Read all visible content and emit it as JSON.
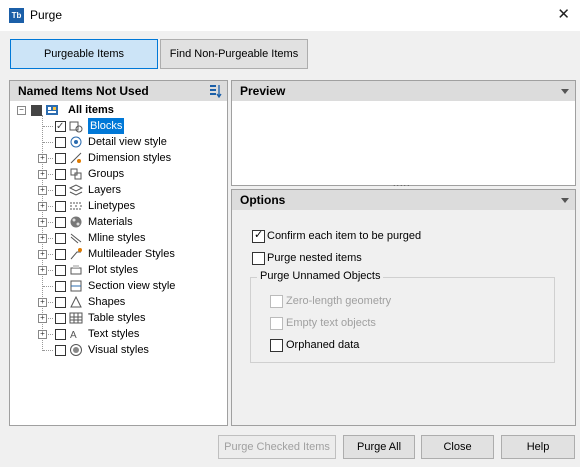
{
  "window": {
    "app_icon": "Tb",
    "title": "Purge",
    "close": "✕"
  },
  "top_buttons": {
    "purgeable": "Purgeable Items",
    "non_purgeable": "Find Non-Purgeable Items"
  },
  "left_panel": {
    "header": "Named Items Not Used",
    "root": "All items",
    "items": [
      {
        "label": "Blocks",
        "icon": "blocks-icon",
        "expandable": false,
        "checked": true,
        "selected": true
      },
      {
        "label": "Detail view style",
        "icon": "detail-view-icon",
        "expandable": false,
        "checked": false
      },
      {
        "label": "Dimension styles",
        "icon": "dimension-icon",
        "expandable": true,
        "checked": false
      },
      {
        "label": "Groups",
        "icon": "groups-icon",
        "expandable": true,
        "checked": false
      },
      {
        "label": "Layers",
        "icon": "layers-icon",
        "expandable": true,
        "checked": false
      },
      {
        "label": "Linetypes",
        "icon": "linetypes-icon",
        "expandable": true,
        "checked": false
      },
      {
        "label": "Materials",
        "icon": "materials-icon",
        "expandable": true,
        "checked": false
      },
      {
        "label": "Mline styles",
        "icon": "mline-icon",
        "expandable": true,
        "checked": false
      },
      {
        "label": "Multileader Styles",
        "icon": "multileader-icon",
        "expandable": true,
        "checked": false
      },
      {
        "label": "Plot styles",
        "icon": "plot-icon",
        "expandable": true,
        "checked": false
      },
      {
        "label": "Section view style",
        "icon": "section-view-icon",
        "expandable": false,
        "checked": false
      },
      {
        "label": "Shapes",
        "icon": "shapes-icon",
        "expandable": true,
        "checked": false
      },
      {
        "label": "Table styles",
        "icon": "table-icon",
        "expandable": true,
        "checked": false
      },
      {
        "label": "Text styles",
        "icon": "text-icon",
        "expandable": true,
        "checked": false
      },
      {
        "label": "Visual styles",
        "icon": "visual-icon",
        "expandable": false,
        "checked": false
      }
    ]
  },
  "preview": {
    "header": "Preview",
    "splitter": "....."
  },
  "options": {
    "header": "Options",
    "confirm": "Confirm each item to be purged",
    "confirm_checked": true,
    "nested": "Purge nested items",
    "nested_checked": false,
    "unnamed_group": "Purge Unnamed Objects",
    "zero_length": "Zero-length geometry",
    "empty_text": "Empty text objects",
    "orphaned": "Orphaned data",
    "orphaned_checked": false
  },
  "bottom_buttons": {
    "purge_checked": "Purge Checked Items",
    "purge_all": "Purge All",
    "close": "Close",
    "help": "Help"
  },
  "colors": {
    "selection": "#0078d7",
    "active_button": "#cce4f7"
  }
}
